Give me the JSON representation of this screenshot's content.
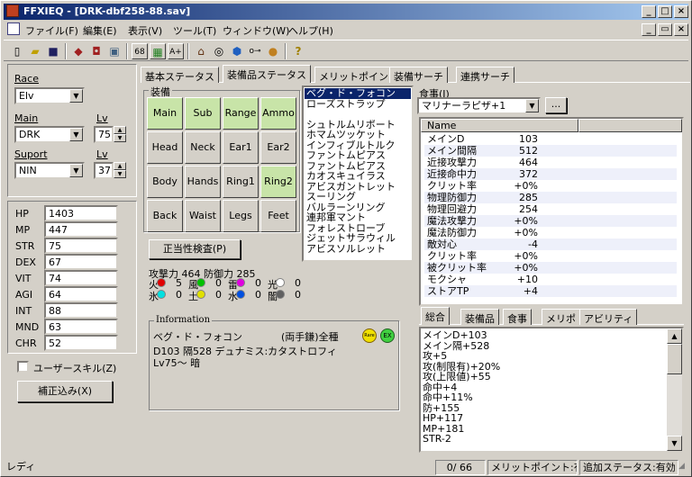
{
  "window": {
    "title": "FFXIEQ - [DRK-dbf258-88.sav]"
  },
  "menu": [
    "ファイル(F)",
    "編集(E)",
    "表示(V)",
    "ツール(T)",
    "ウィンドウ(W)",
    "ヘルプ(H)"
  ],
  "toolbar_icons": [
    "new-file-icon",
    "open-folder-icon",
    "save-icon",
    "cards-icon",
    "edit-icon",
    "window-icon",
    "num-68-icon",
    "grid-icon",
    "text-a-icon",
    "house-icon",
    "compass-icon",
    "globe-icon",
    "key-icon",
    "food-icon",
    "help-icon"
  ],
  "left": {
    "race_label": "Race",
    "race": "Elv",
    "main_label": "Main",
    "main": "DRK",
    "lv_label": "Lv",
    "main_lv": "75",
    "sup_label": "Suport",
    "sup": "NIN",
    "sup_lv_label": "Lv",
    "sup_lv": "37",
    "stats": [
      {
        "k": "HP",
        "v": "1403"
      },
      {
        "k": "MP",
        "v": "447"
      },
      {
        "k": "STR",
        "v": "75"
      },
      {
        "k": "DEX",
        "v": "67"
      },
      {
        "k": "VIT",
        "v": "74"
      },
      {
        "k": "AGI",
        "v": "64"
      },
      {
        "k": "INT",
        "v": "88"
      },
      {
        "k": "MND",
        "v": "63"
      },
      {
        "k": "CHR",
        "v": "52"
      }
    ],
    "user_skill": "ユーザースキル(Z)",
    "apply_btn": "補正込み(X)"
  },
  "tabs": [
    "基本ステータス",
    "装備品ステータス",
    "メリットポイント",
    "装備サーチ",
    "連携サーチ"
  ],
  "equip": {
    "group_label": "装備",
    "slots": [
      "Main",
      "Sub",
      "Range",
      "Ammo",
      "Head",
      "Neck",
      "Ear1",
      "Ear2",
      "Body",
      "Hands",
      "Ring1",
      "Ring2",
      "Back",
      "Waist",
      "Legs",
      "Feet"
    ],
    "check_btn": "正当性検査(P)",
    "atk_def": "攻撃力 464 防御力 285",
    "elements": [
      {
        "n": "火",
        "v": "5",
        "c": "#e00000"
      },
      {
        "n": "風",
        "v": "0",
        "c": "#00c000"
      },
      {
        "n": "雷",
        "v": "0",
        "c": "#e000e0"
      },
      {
        "n": "光",
        "v": "0",
        "c": "#ffffff"
      },
      {
        "n": "氷",
        "v": "0",
        "c": "#00e0e0"
      },
      {
        "n": "土",
        "v": "0",
        "c": "#e0e000"
      },
      {
        "n": "水",
        "v": "0",
        "c": "#0050e0"
      },
      {
        "n": "闇",
        "v": "0",
        "c": "#606060"
      }
    ]
  },
  "items": [
    "ベグ・ド・フォコン",
    "ローズストラップ",
    "",
    "シュトルムリポート",
    "ホマムツッケット",
    "インフィブルトルク",
    "ファントムピアス",
    "ファントムピアス",
    "カオスキュイラス",
    "アビスガントレット",
    "スーリング",
    "バルラーンリング",
    "連邦軍マント",
    "フォレストローブ",
    "ジェットサラウィル",
    "アビスソルレット"
  ],
  "food": {
    "label": "食事(J)",
    "value": "マリナーラピザ+1",
    "btn": "..."
  },
  "stat_list": {
    "header": "Name",
    "rows": [
      [
        "メインD",
        "103"
      ],
      [
        "メイン間隔",
        "512"
      ],
      [
        "近接攻撃力",
        "464"
      ],
      [
        "近接命中力",
        "372"
      ],
      [
        "クリット率",
        "+0%"
      ],
      [
        "物理防御力",
        "285"
      ],
      [
        "物理回避力",
        "254"
      ],
      [
        "魔法攻撃力",
        "+0%"
      ],
      [
        "魔法防御力",
        "+0%"
      ],
      [
        "敵対心",
        "-4"
      ],
      [
        "クリット率",
        "+0%"
      ],
      [
        "被クリット率",
        "+0%"
      ],
      [
        "モクシャ",
        "+10"
      ],
      [
        "ストアTP",
        "+4"
      ]
    ]
  },
  "info": {
    "label": "Information",
    "name": "ベグ・ド・フォコン",
    "type": "(両手鎌)全種",
    "badge1": "Rare",
    "badge2": "EX",
    "line2": "D103 隔528 デュナミス:カタストロフィ",
    "line3": "Lv75～ 暗"
  },
  "subtabs": [
    "総合",
    "装備品",
    "食事",
    "メリポ",
    "アビリティ"
  ],
  "summary": [
    "メインD+103",
    "メイン隔+528",
    "攻+5",
    "攻(制限有)+20%",
    "攻(上限値)+55",
    "命中+4",
    "命中+11%",
    "防+155",
    "HP+117",
    "MP+181",
    "STR-2"
  ],
  "status": {
    "ready": "レディ",
    "count": "0/ 66",
    "merit": "メリットポイント:有効",
    "extra": "追加ステータス:有効"
  }
}
